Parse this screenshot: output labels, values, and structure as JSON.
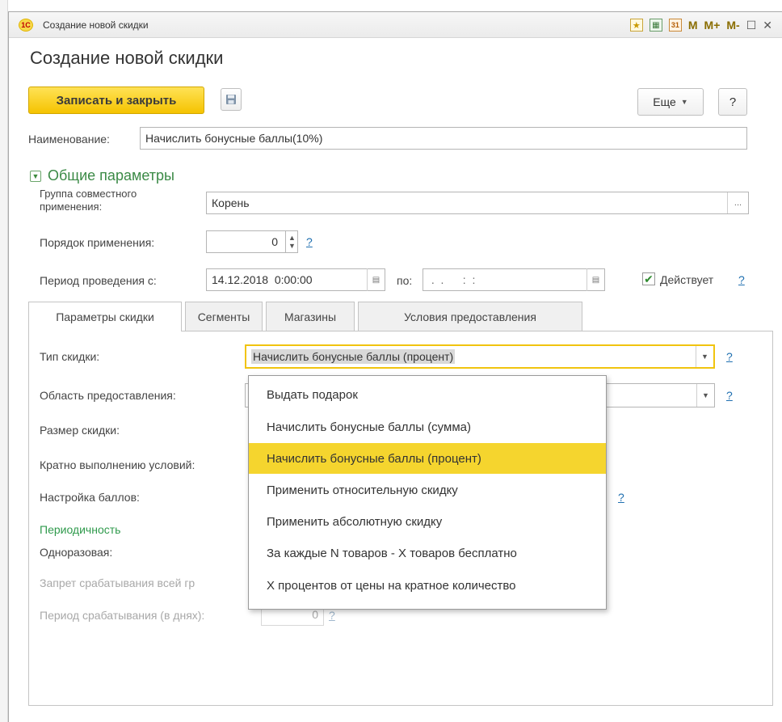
{
  "window": {
    "title": "Создание новой скидки",
    "logo_text": "1С",
    "toolbar_icons": [
      "star-icon",
      "calculator-icon",
      "calendar-icon"
    ],
    "calendar_icon_text": "31",
    "memory_buttons": [
      "M",
      "M+",
      "M-"
    ],
    "maximize_glyph": "☐",
    "close_glyph": "✕"
  },
  "form": {
    "heading": "Создание новой скидки",
    "save_close_label": "Записать и закрыть",
    "more_label": "Еще",
    "help_label": "?",
    "name_label": "Наименование:",
    "name_value": "Начислить бонусные баллы(10%)"
  },
  "general": {
    "section_title": "Общие параметры",
    "group_label_line1": "Группа совместного",
    "group_label_line2": "применения:",
    "group_value": "Корень",
    "group_select_glyph": "...",
    "order_label": "Порядок применения:",
    "order_value": "0",
    "order_help": "?",
    "period_label": "Период проведения с:",
    "period_from": "14.12.2018  0:00:00",
    "period_to_label": "по:",
    "period_to": " .  .      :  :",
    "active_label": "Действует",
    "active_checked": true,
    "active_help": "?"
  },
  "tabs": [
    {
      "label": "Параметры скидки",
      "active": true
    },
    {
      "label": "Сегменты",
      "active": false
    },
    {
      "label": "Магазины",
      "active": false
    },
    {
      "label": "Условия предоставления",
      "active": false
    }
  ],
  "discount_params": {
    "type_label": "Тип скидки:",
    "type_value": "Начислить бонусные баллы (процент)",
    "type_help": "?",
    "area_label": "Область предоставления:",
    "area_help": "?",
    "size_label": "Размер скидки:",
    "multiple_label": "Кратно выполнению условий:",
    "points_label": "Настройка баллов:",
    "points_help": "?",
    "periodicity_title": "Периодичность",
    "one_time_label": "Одноразовая:",
    "prohibit_label": "Запрет срабатывания всей гр",
    "period_days_label": "Период срабатывания (в днях):",
    "period_days_value": "0",
    "period_days_help": "?"
  },
  "dropdown": {
    "options": [
      "Выдать подарок",
      "Начислить бонусные баллы (сумма)",
      "Начислить бонусные баллы (процент)",
      "Применить относительную скидку",
      "Применить абсолютную скидку",
      "За каждые N товаров - X товаров бесплатно",
      "X процентов от цены на кратное количество"
    ],
    "selected_index": 2
  },
  "colors": {
    "accent_yellow": "#f5c300",
    "section_green": "#3b8a46",
    "link_blue": "#1f6fb0",
    "highlight_row": "#f5d52e"
  }
}
